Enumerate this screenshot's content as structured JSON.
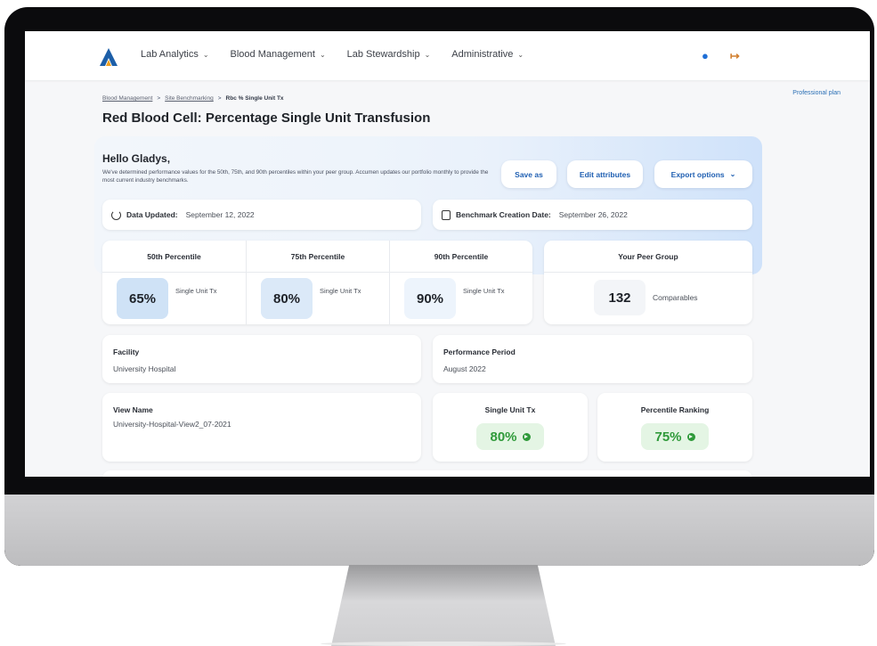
{
  "nav": {
    "items": [
      {
        "label": "Lab Analytics"
      },
      {
        "label": "Blood Management"
      },
      {
        "label": "Lab Stewardship"
      },
      {
        "label": "Administrative"
      }
    ]
  },
  "plan_label": "Professional plan",
  "breadcrumb": {
    "items": [
      "Blood Management",
      "Site Benchmarking",
      "Rbc % Single Unit Tx"
    ],
    "separator": ">"
  },
  "page_title": "Red Blood Cell: Percentage Single Unit Transfusion",
  "hero": {
    "greeting": "Hello Gladys,",
    "description": "We've determined performance values for the 50th, 75th, and 90th percentiles within your peer group. Accumen updates our portfolio monthly to provide the most current industry benchmarks.",
    "buttons": {
      "save": "Save as",
      "edit": "Edit attributes",
      "export": "Export options"
    }
  },
  "data_updated": {
    "label": "Data Updated:",
    "value": "September 12, 2022"
  },
  "benchmark_date": {
    "label": "Benchmark Creation Date:",
    "value": "September 26, 2022"
  },
  "percentiles": [
    {
      "header": "50th Percentile",
      "value": "65%",
      "unit": "Single Unit Tx",
      "color": "#cfe2f6"
    },
    {
      "header": "75th Percentile",
      "value": "80%",
      "unit": "Single Unit Tx",
      "color": "#dbe9f8"
    },
    {
      "header": "90th Percentile",
      "value": "90%",
      "unit": "Single Unit Tx",
      "color": "#edf4fc"
    }
  ],
  "peer_group": {
    "header": "Your Peer Group",
    "value": "132",
    "unit": "Comparables"
  },
  "facility": {
    "label": "Facility",
    "value": "University Hospital"
  },
  "performance_period": {
    "label": "Performance Period",
    "value": "August 2022"
  },
  "view_name": {
    "label": "View Name",
    "value": "University-Hospital-View2_07-2021"
  },
  "single_unit": {
    "label": "Single Unit Tx",
    "value": "80%"
  },
  "percentile_ranking": {
    "label": "Percentile Ranking",
    "value": "75%"
  },
  "colors": {
    "accent": "#1f5fb2",
    "positive": "#2f9a3a",
    "logo_blue": "#1d5fa8",
    "logo_orange": "#f0a020"
  }
}
